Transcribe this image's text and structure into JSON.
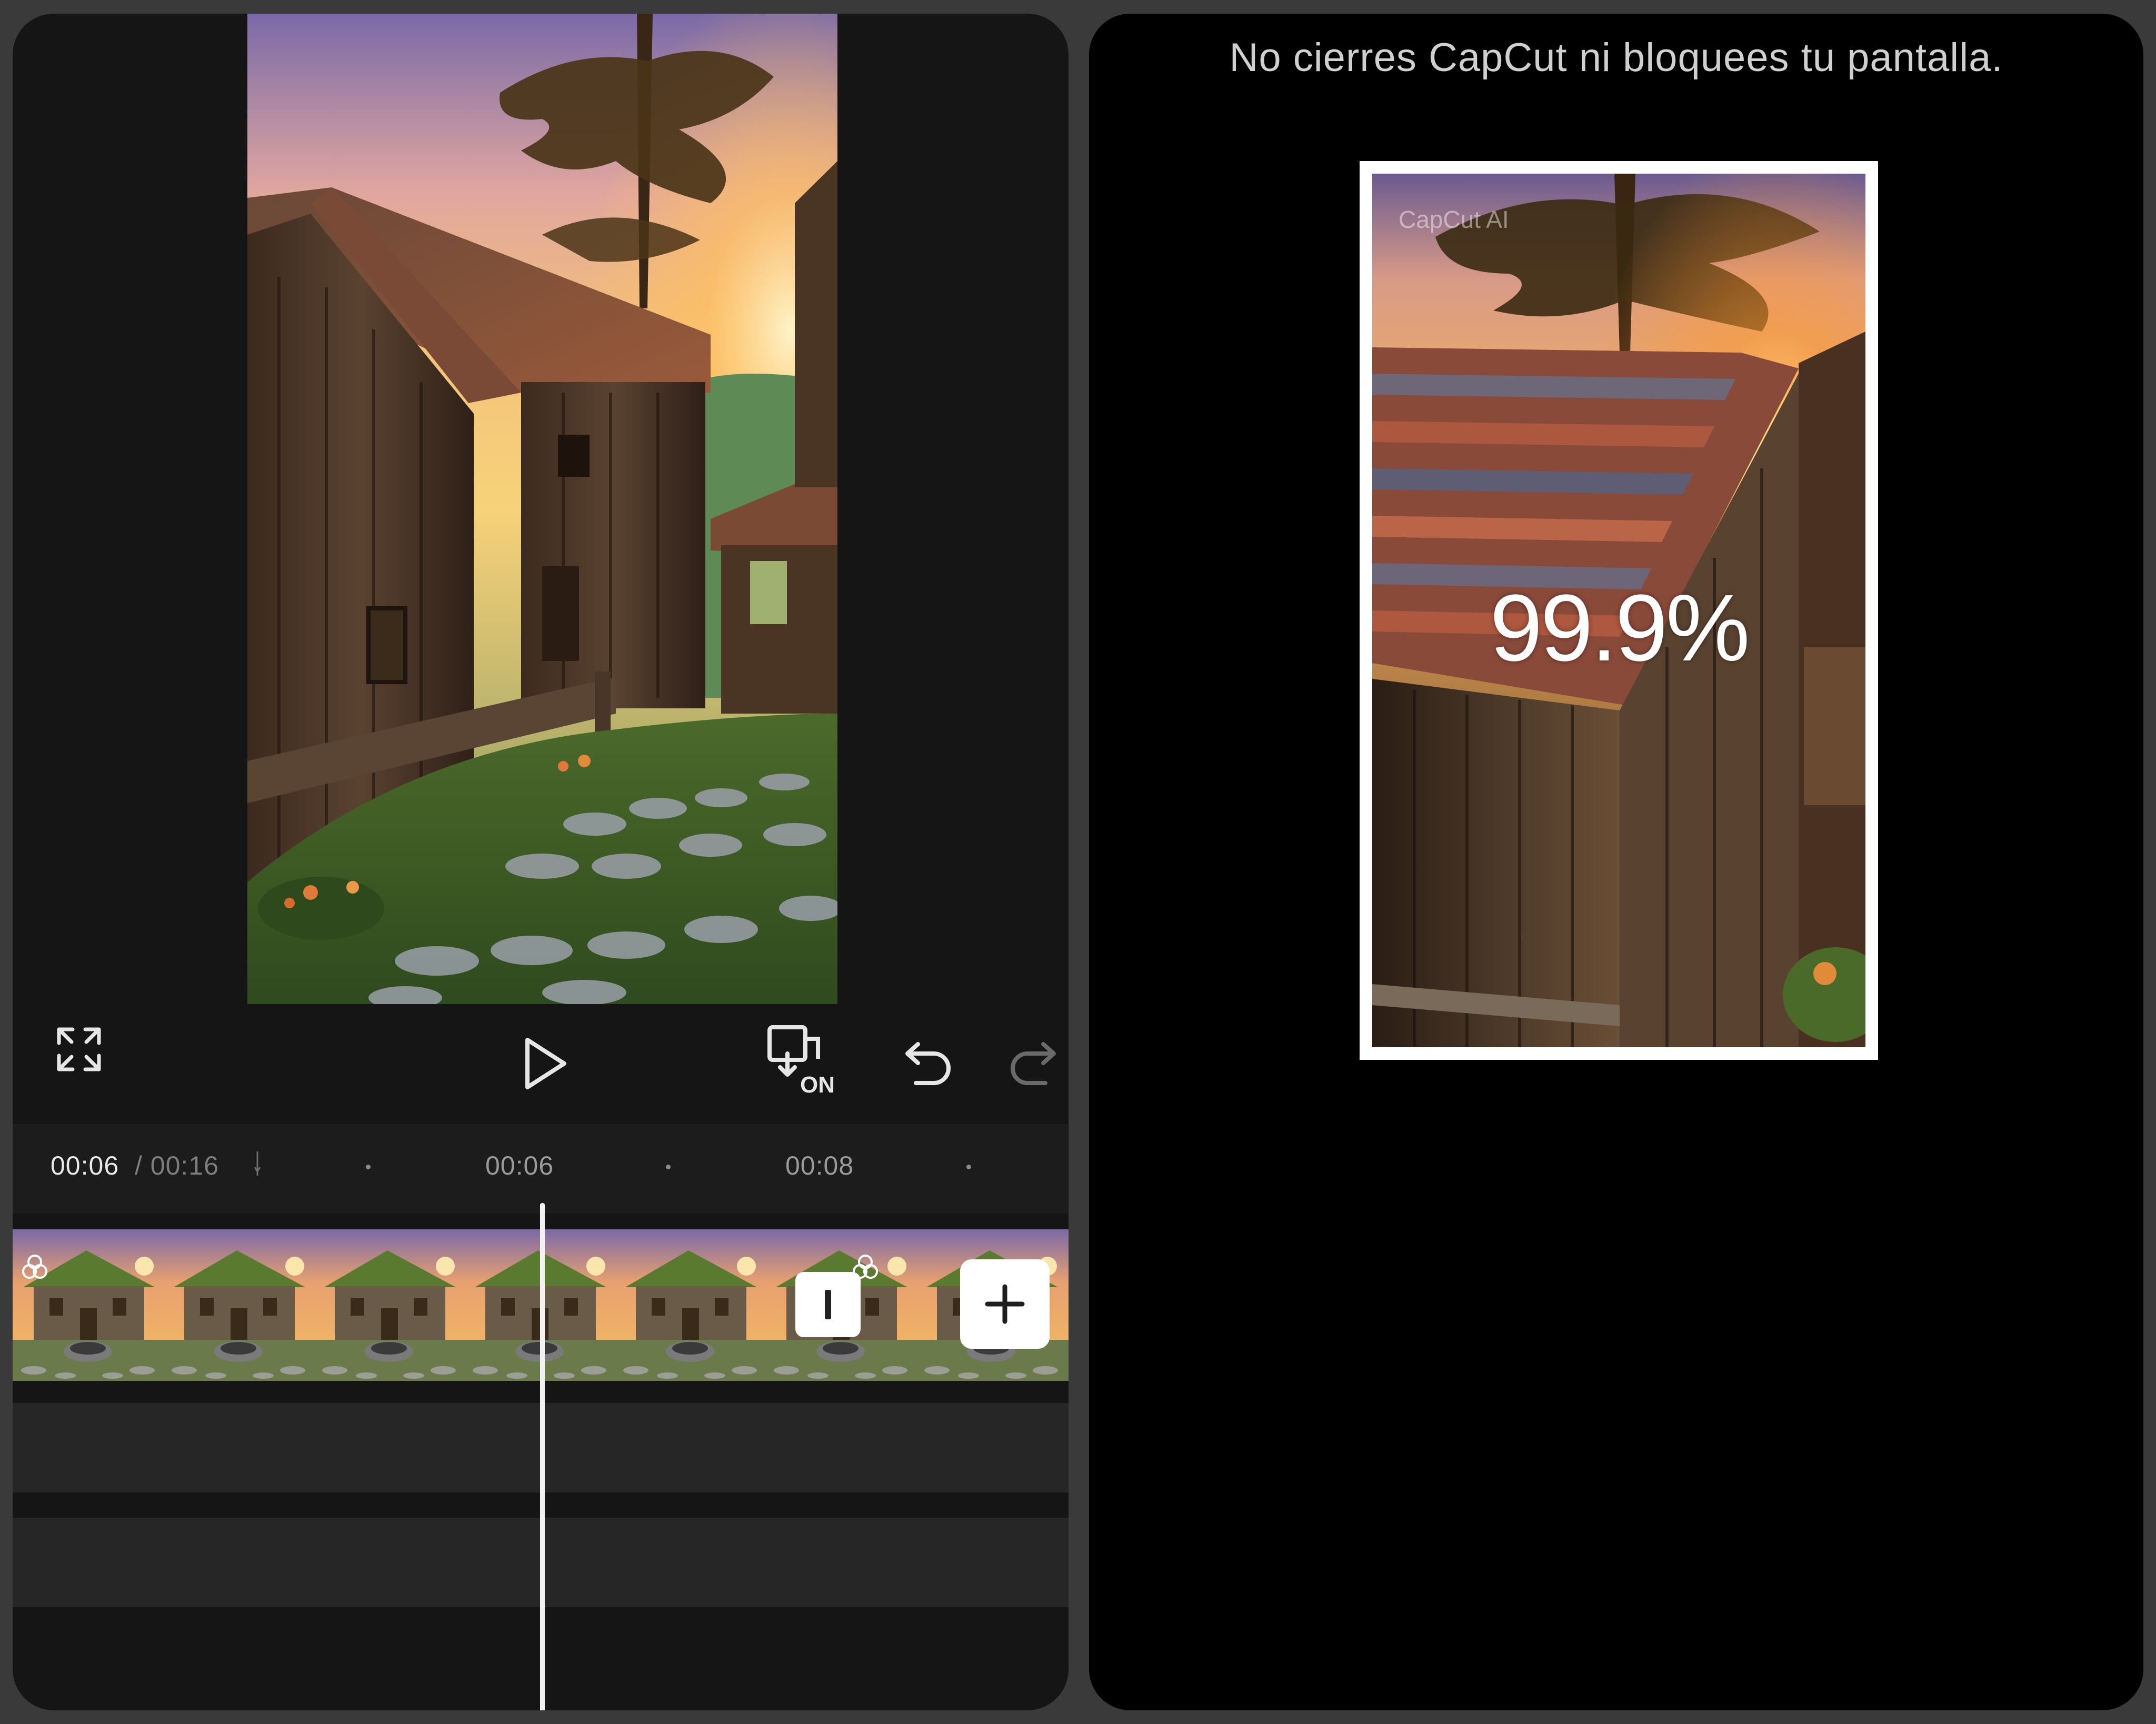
{
  "editor": {
    "preview": {
      "watermark": "CapCut AI",
      "image": "rustic wooden cabin at sunset"
    },
    "toolbar": {
      "fullscreen_icon": "fullscreen-icon",
      "play_icon": "play-icon",
      "keyframe_toggle_icon": "keyframe-on-icon",
      "keyframe_toggle_label": "ON",
      "undo_icon": "undo-icon",
      "redo_icon": "redo-icon"
    },
    "ruler": {
      "current_time": "00:06",
      "total_time": "/ 00:16",
      "ticks": [
        "00:06",
        "00:08"
      ]
    },
    "timeline": {
      "clip_thumbnail": "stone cottage with well",
      "transition_icon": "transition-icon",
      "add_clip_icon": "plus-icon"
    }
  },
  "export": {
    "message": "No cierres CapCut ni bloquees tu pantalla.",
    "watermark": "CapCut AI",
    "progress_text": "99.9%",
    "progress": 0.999
  },
  "colors": {
    "editor_bg": "#151515",
    "export_bg": "#000000",
    "accent": "#ffffff"
  }
}
